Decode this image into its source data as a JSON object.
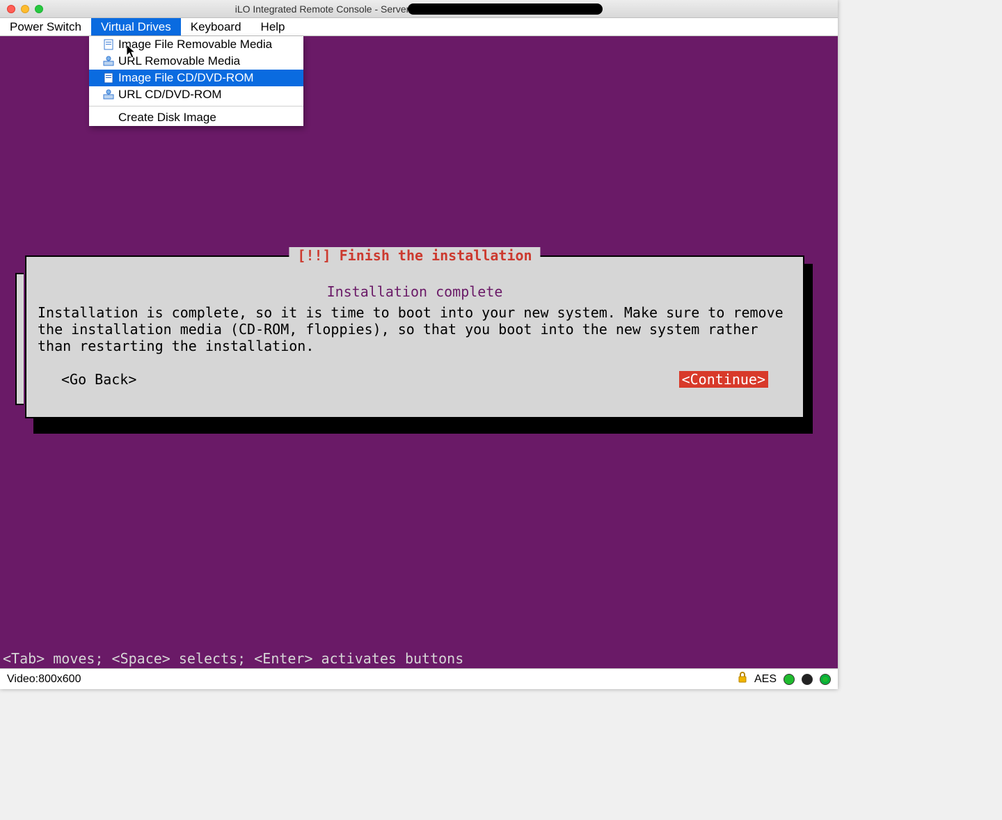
{
  "titlebar": {
    "title_prefix": "iLO Integrated Remote Console - Server"
  },
  "menubar": {
    "items": [
      {
        "label": "Power Switch"
      },
      {
        "label": "Virtual Drives"
      },
      {
        "label": "Keyboard"
      },
      {
        "label": "Help"
      }
    ],
    "active_index": 1
  },
  "dropdown": {
    "items": [
      {
        "label": "Image File Removable Media",
        "icon": "file"
      },
      {
        "label": "URL Removable Media",
        "icon": "net"
      },
      {
        "label": "Image File CD/DVD-ROM",
        "icon": "file",
        "highlight": true
      },
      {
        "label": "URL CD/DVD-ROM",
        "icon": "net"
      }
    ],
    "secondary": [
      {
        "label": "Create Disk Image"
      }
    ]
  },
  "installer": {
    "frame_title": "[!!] Finish the installation",
    "heading": "Installation complete",
    "body": "Installation is complete, so it is time to boot into your new system. Make sure to remove the installation media (CD-ROM, floppies), so that you boot into the new system rather than restarting the installation.",
    "go_back": "<Go Back>",
    "continue": "<Continue>"
  },
  "hint": "<Tab> moves; <Space> selects; <Enter> activates buttons",
  "statusbar": {
    "video": "Video:800x600",
    "crypto": "AES"
  }
}
